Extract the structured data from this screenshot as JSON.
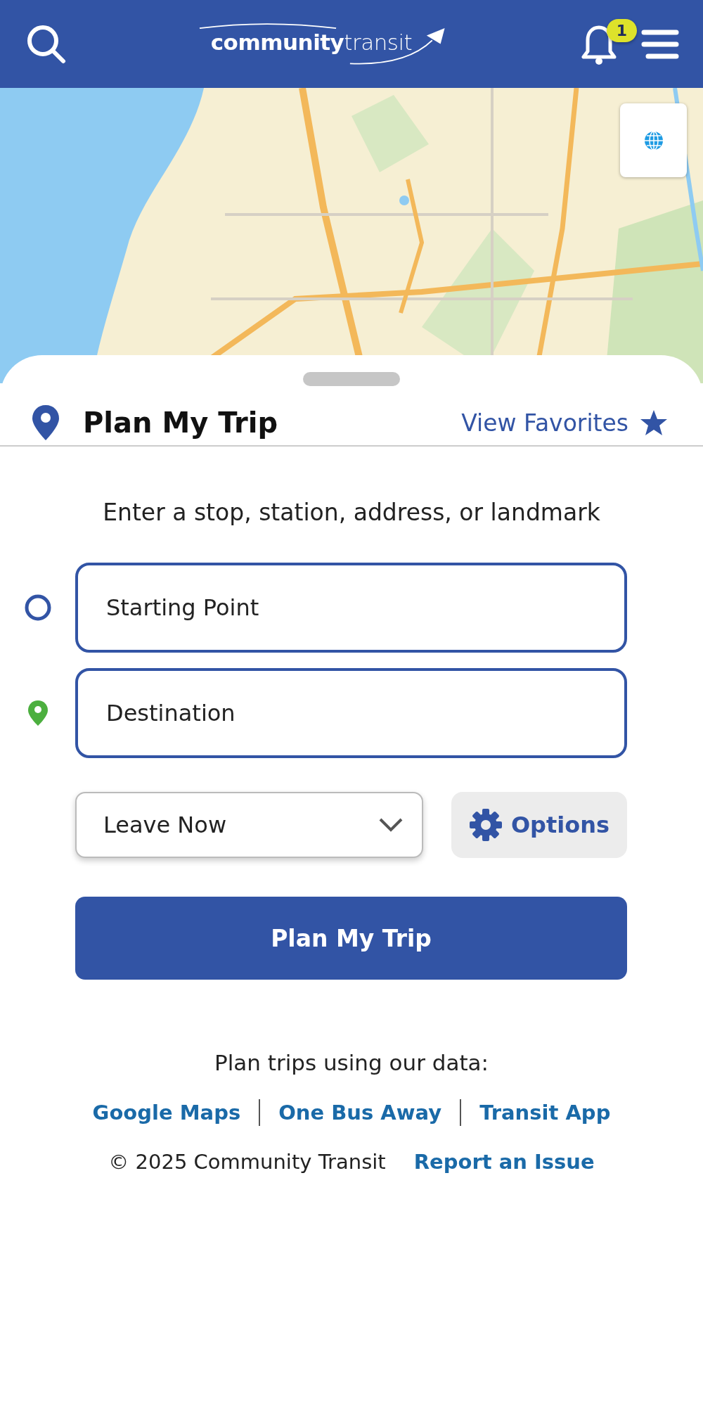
{
  "header": {
    "logo": "**community**transit",
    "notifications": {
      "count": "1"
    }
  },
  "planner": {
    "title": "Plan My Trip",
    "favorites_link": "View Favorites",
    "hint": "Enter a stop, station, address, or landmark",
    "origin": {
      "placeholder": "Starting Point"
    },
    "destination": {
      "placeholder": "Destination"
    },
    "time_select": {
      "value": "Leave Now"
    },
    "options_button": "Options",
    "submit_button": "Plan My Trip"
  },
  "footer": {
    "intro": "Plan trips using our data:",
    "links": [
      "Google Maps",
      "One Bus Away",
      "Transit App"
    ],
    "copyright": "© 2025 Community Transit",
    "report_link": "Report an Issue"
  }
}
